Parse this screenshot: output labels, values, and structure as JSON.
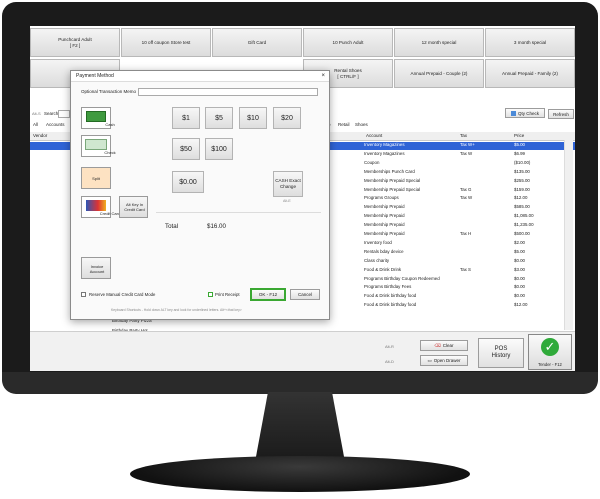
{
  "products": [
    "Punchcard Adult\n[ F2 ]",
    "10 off coupon Store test",
    "Gift Card",
    "10 Punch Adult",
    "12 month special",
    "3 month special",
    "Rental Shoes\n[ CTRL/F ]",
    "Annual Prepaid - Couple (2)",
    "Annual Prepaid - Family (2)"
  ],
  "search": {
    "label": "Search",
    "alt_hint": "Alt-S",
    "qty_check": "Qty Check",
    "refresh": "Refresh"
  },
  "tabs": {
    "all": "All",
    "accounts": "Accounts",
    "retail": "Retail",
    "shoes": "Shoes",
    "sb": "b"
  },
  "table": {
    "left_header": "Vendor",
    "headers": [
      "Account",
      "Tax",
      "Price"
    ],
    "rows": [
      {
        "account": "Inventory Magazines",
        "tax": "Tax W+",
        "price": "$5.00",
        "selected": true
      },
      {
        "account": "Inventory Magazines",
        "tax": "Tax W",
        "price": "$6.99"
      },
      {
        "account": "Coupon",
        "tax": "",
        "price": "($10.00)"
      },
      {
        "account": "Memberships Punch Card",
        "tax": "",
        "price": "$135.00"
      },
      {
        "account": "Membership Prepaid Special",
        "tax": "",
        "price": "$255.00"
      },
      {
        "account": "Membership Prepaid Special",
        "tax": "Tax G",
        "price": "$159.00"
      },
      {
        "account": "Programs Groups",
        "tax": "Tax W",
        "price": "$12.00"
      },
      {
        "account": "Membership Prepaid",
        "tax": "",
        "price": "$585.00"
      },
      {
        "account": "Membership Prepaid",
        "tax": "",
        "price": "$1,085.00"
      },
      {
        "account": "Membership Prepaid",
        "tax": "",
        "price": "$1,235.00"
      },
      {
        "account": "Membership Prepaid",
        "tax": "Tax H",
        "price": "$500.00"
      },
      {
        "account": "Inventory food",
        "tax": "",
        "price": "$2.00"
      },
      {
        "account": "Rentals bday device",
        "tax": "",
        "price": "$5.00"
      },
      {
        "account": "Class charity",
        "tax": "",
        "price": "$0.00"
      },
      {
        "account": "Food & Drink Drink",
        "tax": "Tax S",
        "price": "$3.00"
      },
      {
        "account": "Programs Birthday Coupon Redeemed",
        "tax": "",
        "price": "$0.00"
      },
      {
        "account": "Programs Birthday Fees",
        "tax": "",
        "price": "$0.00"
      },
      {
        "account": "Food & Drink birthday food",
        "tax": "",
        "price": "$0.00"
      },
      {
        "account": "Food & Drink birthday food",
        "tax": "",
        "price": "$12.00"
      }
    ],
    "left_rows": [
      "Birthday Party Pizza",
      "Birthday Party Hot"
    ]
  },
  "bottom": {
    "clear": "Clear",
    "clear_hint": "Alt-R",
    "open_drawer": "Open Drawer",
    "drawer_hint": "Alt-D",
    "pos_history": "POS\nHistory",
    "tender": "Tender - F12"
  },
  "dialog": {
    "title": "Payment Method",
    "close": "×",
    "memo_label": "Optional Transaction Memo",
    "tiles": {
      "cash": "Cash",
      "check": "Check",
      "split": "Split",
      "credit": "Credit Card",
      "key_in": "Alt Key In Credit Card",
      "invoice": "Invoice Account"
    },
    "denoms": [
      "$1",
      "$5",
      "$10",
      "$20",
      "$50",
      "$100",
      "$0.00"
    ],
    "exact": "CASH Exact Change",
    "exact_hint": "Alt-E",
    "total_label": "Total",
    "total_value": "$16.00",
    "reswipe": "Reserve Manual Credit Card Mode",
    "print_receipt": "Print Receipt",
    "ok": "OK - F12",
    "cancel": "Cancel",
    "footer_hint": "Keyboard Shortcuts - Hold down ALT key and look for underlined letters. Alt+<that key>"
  },
  "colors": {
    "selected_row": "#2f63d6",
    "ok_border": "#3aa832",
    "tender_green": "#2faa3a"
  }
}
